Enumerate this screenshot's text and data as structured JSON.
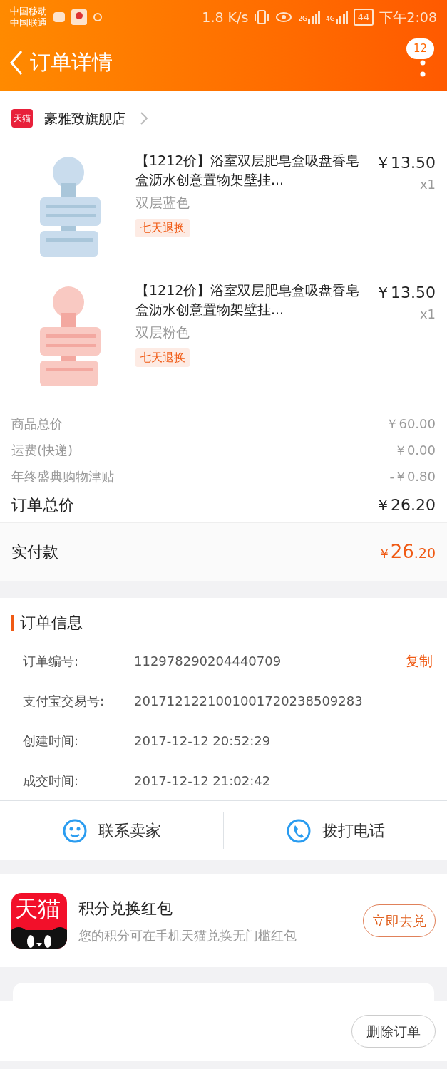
{
  "status_bar": {
    "carriers": [
      "中国移动",
      "中国联通"
    ],
    "speed": "1.8 K/s",
    "networks": [
      "2G",
      "4G"
    ],
    "battery": "44",
    "time": "下午2:08"
  },
  "header": {
    "title": "订单详情",
    "badge": "12"
  },
  "store": {
    "logo": "天猫",
    "name": "豪雅致旗舰店"
  },
  "items": [
    {
      "title": "【1212价】浴室双层肥皂盒吸盘香皂盒沥水创意置物架壁挂...",
      "price": "￥13.50",
      "qty": "x1",
      "sku": "双层蓝色",
      "tag": "七天退换"
    },
    {
      "title": "【1212价】浴室双层肥皂盒吸盘香皂盒沥水创意置物架壁挂...",
      "price": "￥13.50",
      "qty": "x1",
      "sku": "双层粉色",
      "tag": "七天退换"
    }
  ],
  "price_rows": [
    {
      "kind": "minor",
      "label": "商品总价",
      "value": "￥60.00"
    },
    {
      "kind": "minor",
      "label": "运费(快递)",
      "value": "￥0.00"
    },
    {
      "kind": "minor",
      "label": "年终盛典购物津贴",
      "value": "-￥0.80"
    },
    {
      "kind": "total",
      "label": "订单总价",
      "value": "￥26.20"
    }
  ],
  "paid": {
    "label": "实付款",
    "symbol": "￥",
    "main": "26",
    "fraction": ".20"
  },
  "order_info": {
    "title": "订单信息",
    "rows": [
      {
        "label": "订单编号:",
        "value": "112978290204440709",
        "action": "复制"
      },
      {
        "label": "支付宝交易号:",
        "value": "2017121221001001720238509283"
      },
      {
        "label": "创建时间:",
        "value": "2017-12-12 20:52:29"
      },
      {
        "label": "成交时间:",
        "value": "2017-12-12 21:02:42"
      }
    ]
  },
  "contact": [
    {
      "kind": "chat",
      "label": "联系卖家"
    },
    {
      "kind": "phone",
      "label": "拨打电话"
    }
  ],
  "promo": {
    "logo": "天猫",
    "title": "积分兑换红包",
    "desc": "您的积分可在手机天猫兑换无门槛红包",
    "button": "立即去兑"
  },
  "bottom": {
    "button": "删除订单"
  }
}
